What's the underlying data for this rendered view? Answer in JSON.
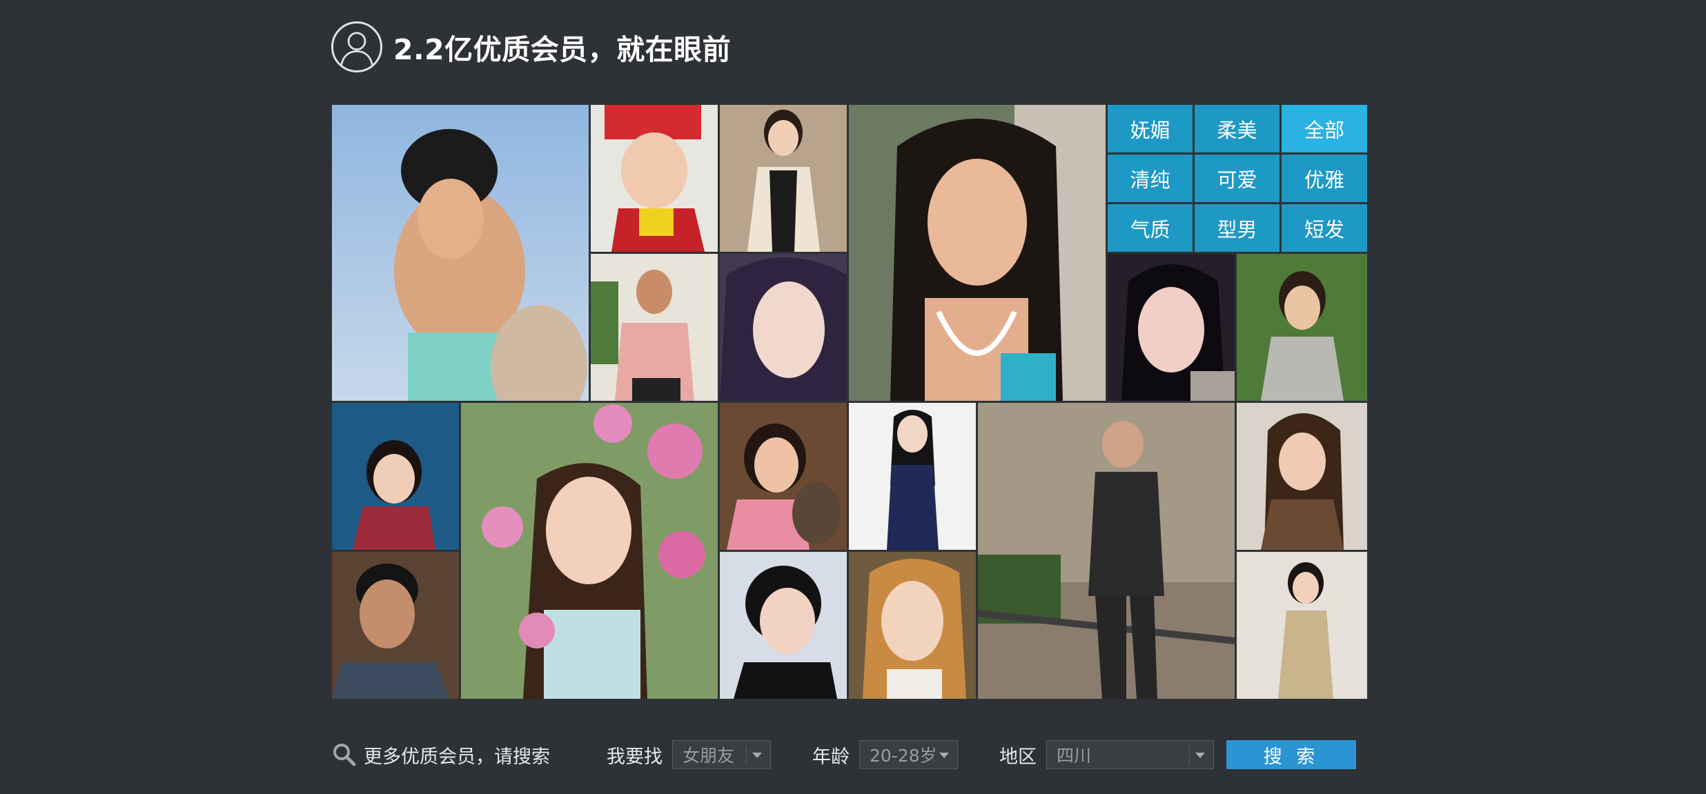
{
  "header": {
    "title": "2.2亿优质会员，就在眼前",
    "icon": "user-outline-icon"
  },
  "tags": [
    {
      "label": "妩媚"
    },
    {
      "label": "柔美"
    },
    {
      "label": "全部"
    },
    {
      "label": "清纯"
    },
    {
      "label": "可爱"
    },
    {
      "label": "优雅"
    },
    {
      "label": "气质"
    },
    {
      "label": "型男"
    },
    {
      "label": "短发"
    }
  ],
  "search": {
    "hint": "更多优质会员，请搜索",
    "seek_label": "我要找",
    "seek_value": "女朋友",
    "age_label": "年龄",
    "age_value": "20-28岁",
    "region_label": "地区",
    "region_value": "四川",
    "button_label": "搜 索"
  },
  "colors": {
    "background": "#2e3135",
    "tag": "#1e98c4",
    "tag_active": "#29b2e2",
    "button": "#2b95d3"
  }
}
